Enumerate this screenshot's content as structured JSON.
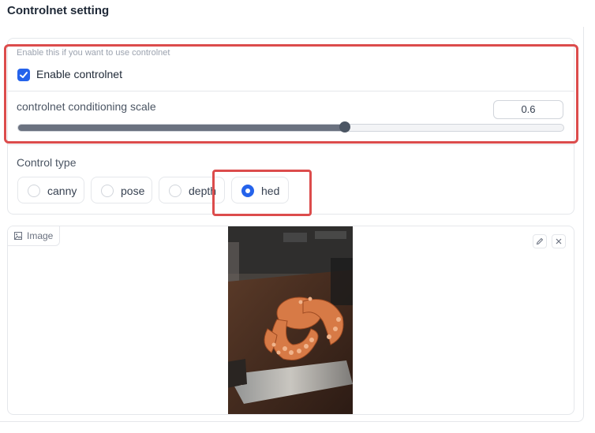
{
  "section_title": "Controlnet setting",
  "enable": {
    "info": "Enable this if you want to use controlnet",
    "label": "Enable controlnet",
    "checked": true
  },
  "scale": {
    "label": "controlnet conditioning scale",
    "value": "0.6",
    "fraction": 0.6
  },
  "control_type": {
    "label": "Control type",
    "options": [
      "canny",
      "pose",
      "depth",
      "hed"
    ],
    "selected": "hed"
  },
  "image": {
    "label": "Image",
    "icons": [
      "image-icon",
      "edit-icon",
      "close-icon"
    ]
  },
  "colors": {
    "accent": "#2563eb",
    "highlight": "#dc4c4c"
  }
}
